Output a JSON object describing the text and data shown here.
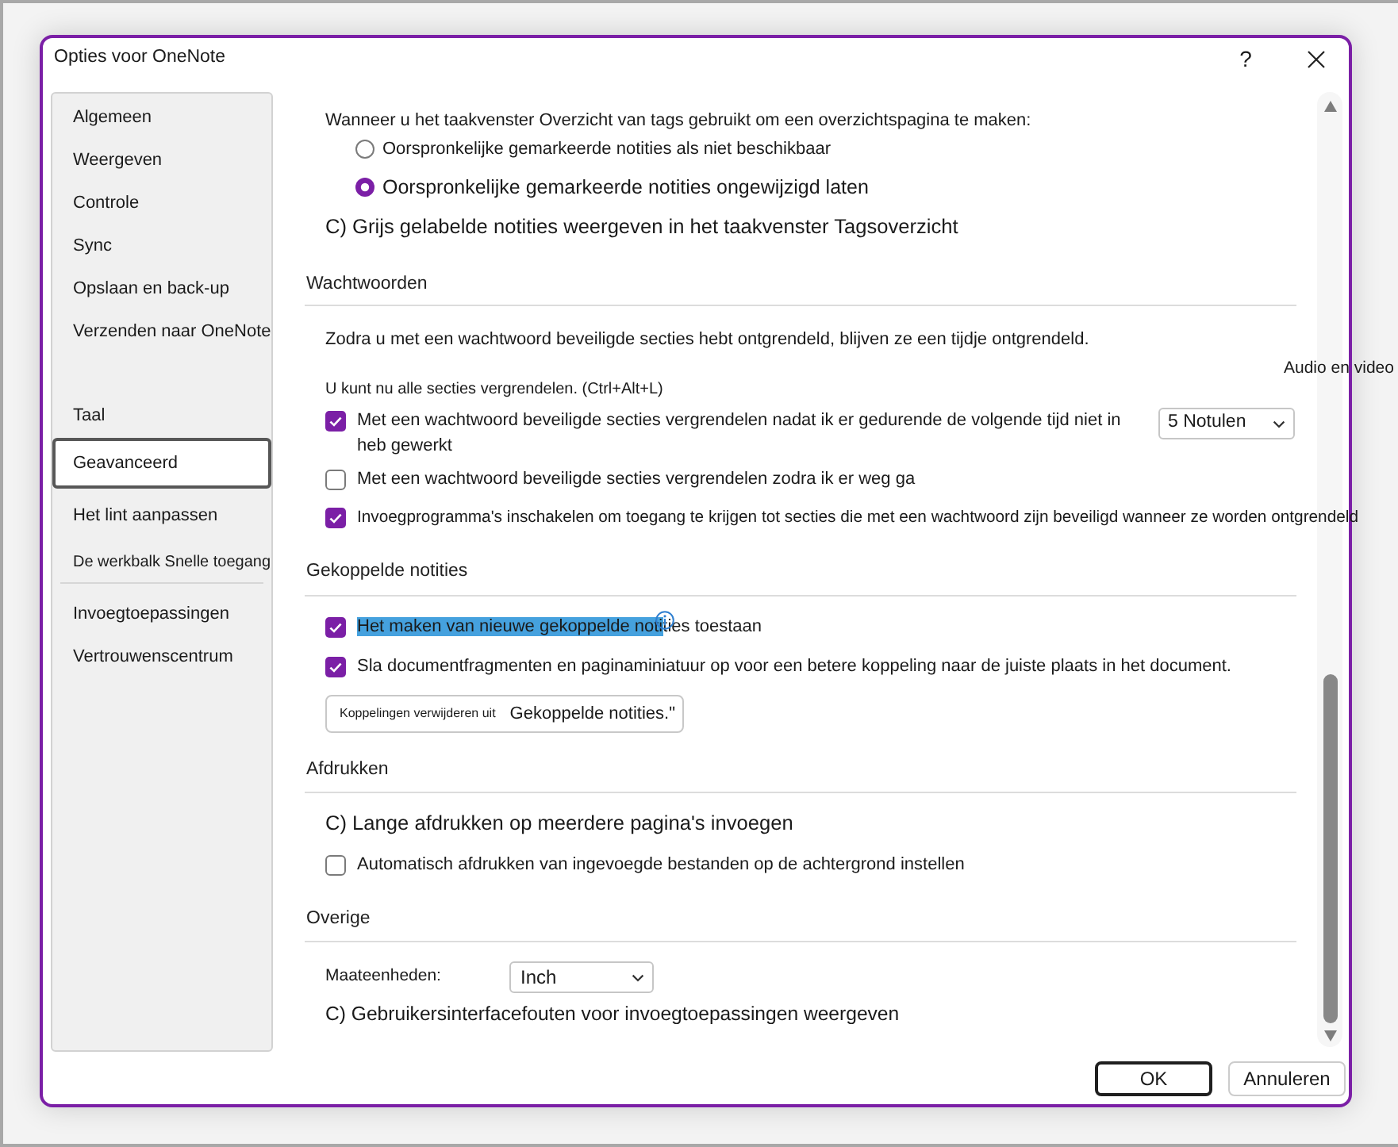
{
  "window": {
    "title": "Opties voor OneNote",
    "help": "?"
  },
  "sidebar": {
    "groups": [
      {
        "items": [
          {
            "label": "Algemeen",
            "selected": false,
            "kind": "normal"
          },
          {
            "label": "Weergeven",
            "selected": false,
            "kind": "normal"
          },
          {
            "label": "Controle",
            "selected": false,
            "kind": "normal"
          },
          {
            "label": "Sync",
            "selected": false,
            "kind": "normal"
          },
          {
            "label": "Opslaan en back-up",
            "selected": false,
            "kind": "normal"
          },
          {
            "label": "Verzenden naar OneNote",
            "selected": false,
            "kind": "normal"
          }
        ]
      },
      {
        "items": [
          {
            "label": "Taal",
            "selected": false,
            "kind": "normal"
          },
          {
            "label": "Geavanceerd",
            "selected": true,
            "kind": "normal"
          },
          {
            "label": "Het lint aanpassen",
            "selected": false,
            "kind": "normal"
          },
          {
            "label": "De werkbalk Snelle toegang",
            "selected": false,
            "kind": "compact"
          }
        ]
      },
      {
        "items": [
          {
            "label": "Invoegtoepassingen",
            "selected": false,
            "kind": "normal"
          },
          {
            "label": "Vertrouwenscentrum",
            "selected": false,
            "kind": "normal"
          }
        ]
      }
    ]
  },
  "content": {
    "sections": [
      {
        "rows": [
          {
            "kind": "text",
            "text": "Wanneer u het taakvenster Overzicht van tags gebruikt om een overzichtspagina te maken:"
          },
          {
            "kind": "radio",
            "label": "Oorspronkelijke gemarkeerde notities als niet beschikbaar",
            "selected": false
          },
          {
            "kind": "radio",
            "label": "Oorspronkelijke gemarkeerde notities ongewijzigd laten",
            "selected": true
          },
          {
            "kind": "text",
            "text": "C) Grijs gelabelde notities weergeven in het taakvenster Tagsoverzicht"
          }
        ]
      },
      {
        "heading": "Wachtwoorden",
        "rows": [
          {
            "kind": "text",
            "text": "Zodra u met een wachtwoord beveiligde secties hebt ontgrendeld, blijven ze een tijdje ontgrendeld."
          },
          {
            "kind": "text",
            "text": "U kunt nu alle secties vergrendelen. (Ctrl+Alt+L)"
          },
          {
            "kind": "checkbox",
            "label": "Met een wachtwoord beveiligde secties vergrendelen nadat ik er gedurende de volgende tijd niet in heb gewerkt",
            "checked": true,
            "dropdown": "5 Notulen"
          },
          {
            "kind": "checkbox",
            "label": "Met een wachtwoord beveiligde secties vergrendelen zodra ik er weg ga",
            "checked": false
          },
          {
            "kind": "checkbox",
            "label": "Invoegprogramma's inschakelen om toegang te krijgen tot secties die met een wachtwoord zijn beveiligd wanneer ze worden ontgrendeld",
            "checked": true
          }
        ]
      },
      {
        "heading": "Gekoppelde notities",
        "rows": [
          {
            "kind": "checkbox",
            "label_parts": [
              {
                "text": "Het maken van nieuwe gekoppelde noti",
                "highlighted": true
              },
              {
                "text": "ties toestaan",
                "highlighted": false
              }
            ],
            "checked": true,
            "info": true
          },
          {
            "kind": "checkbox",
            "label": "Sla documentfragmenten en paginaminiatuur op voor een betere koppeling naar de juiste plaats in het document.",
            "checked": true
          },
          {
            "kind": "button",
            "label": "Koppelingen verwijderen uit",
            "trailing_text": "Gekoppelde notities.\""
          }
        ]
      },
      {
        "heading": "Afdrukken",
        "rows": [
          {
            "kind": "text",
            "text": "C) Lange afdrukken op meerdere pagina's invoegen"
          },
          {
            "kind": "checkbox",
            "label": "Automatisch afdrukken van ingevoegde bestanden op de achtergrond instellen",
            "checked": false
          }
        ]
      },
      {
        "heading": "Overige",
        "rows": [
          {
            "kind": "select",
            "label": "Maateenheden:",
            "value": "Inch"
          },
          {
            "kind": "text",
            "text": "C) Gebruikersinterfacefouten voor invoegtoepassingen weergeven"
          }
        ]
      }
    ]
  },
  "overlay_text": "Audio en video",
  "buttons": [
    {
      "label": "OK",
      "default": true
    },
    {
      "label": "Annuleren",
      "default": false
    }
  ]
}
